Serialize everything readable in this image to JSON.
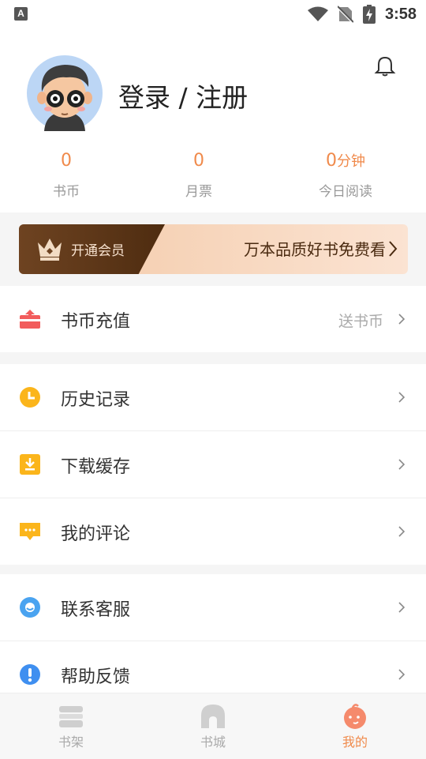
{
  "status_bar": {
    "time": "3:58"
  },
  "profile": {
    "login_label": "登录 / 注册"
  },
  "stats": [
    {
      "value": "0",
      "unit": "",
      "label": "书币"
    },
    {
      "value": "0",
      "unit": "",
      "label": "月票"
    },
    {
      "value": "0",
      "unit": "分钟",
      "label": "今日阅读"
    }
  ],
  "vip_banner": {
    "open_label": "开通会员",
    "promo": "万本品质好书免费看"
  },
  "menu": {
    "recharge": {
      "label": "书币充值",
      "extra": "送书币"
    },
    "history": {
      "label": "历史记录"
    },
    "download": {
      "label": "下载缓存"
    },
    "comments": {
      "label": "我的评论"
    },
    "service": {
      "label": "联系客服"
    },
    "feedback": {
      "label": "帮助反馈"
    }
  },
  "tabs": [
    {
      "label": "书架"
    },
    {
      "label": "书城"
    },
    {
      "label": "我的"
    }
  ],
  "colors": {
    "accent": "#f08a4b",
    "vip_dark": "#5a3416",
    "vip_light": "#f8d6bd"
  }
}
